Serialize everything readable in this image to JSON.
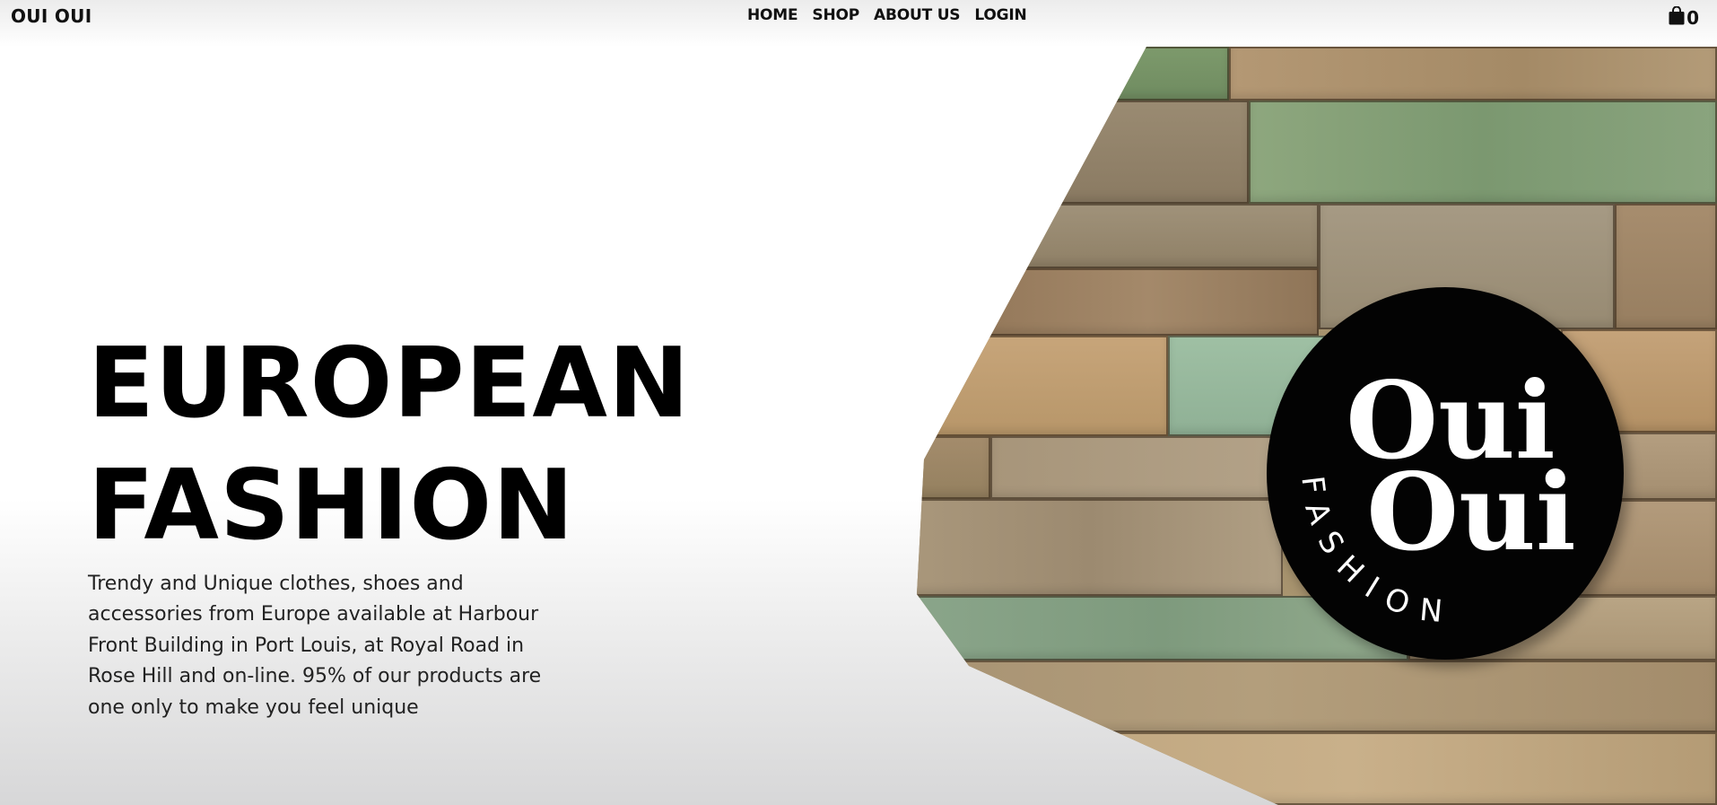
{
  "brand": {
    "name": "OUI OUI"
  },
  "nav": {
    "items": [
      {
        "label": "HOME"
      },
      {
        "label": "SHOP"
      },
      {
        "label": "ABOUT US"
      },
      {
        "label": "LOGIN"
      }
    ]
  },
  "cart": {
    "icon": "shopping-bag-icon",
    "count": "0"
  },
  "hero": {
    "title_line1": "EUROPEAN",
    "title_line2": "FASHION",
    "description": "Trendy and Unique clothes, shoes and accessories from Europe available at Harbour Front Building in Port Louis, at Royal Road in Rose Hill and on-line. 95% of our products are one only to make you feel unique"
  },
  "logo": {
    "line1": "Oui",
    "line2": "Oui",
    "tagline": "FASHION",
    "background_color": "#000000",
    "text_color": "#ffffff"
  },
  "colors": {
    "text": "#111111",
    "wood_green": "#7f9a78",
    "wood_tan": "#b89a6e"
  }
}
